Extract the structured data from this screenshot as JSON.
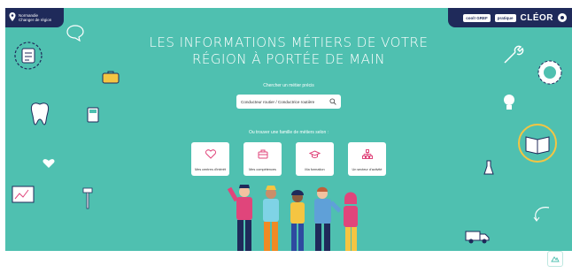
{
  "header": {
    "region_label_lines": [
      "Normandie",
      "Changer de région"
    ],
    "badges": [
      "cool! GREF",
      "pratique"
    ],
    "brand": "CLÉOR"
  },
  "hero": {
    "headline_line1": "LES INFORMATIONS MÉTIERS DE VOTRE",
    "headline_line2": "RÉGION À PORTÉE DE MAIN",
    "search_label": "Chercher un métier précis",
    "search_placeholder": "Conducteur routier / Conductrice routière",
    "browse_label": "Ou trouver une famille de métiers selon :",
    "cards": [
      {
        "icon": "heart-icon",
        "label": "Mes centres d'intérêt"
      },
      {
        "icon": "briefcase-icon",
        "label": "Mes compétences"
      },
      {
        "icon": "graduation-cap-icon",
        "label": "Ma formation"
      },
      {
        "icon": "org-chart-icon",
        "label": "Un secteur d'activité"
      }
    ]
  },
  "colors": {
    "hero_bg": "#4fc0b0",
    "nav_bg": "#1f2a5a",
    "accent_pink": "#e0457b",
    "accent_orange": "#f08a24"
  },
  "widget": {
    "icon": "accessibility-icon"
  }
}
